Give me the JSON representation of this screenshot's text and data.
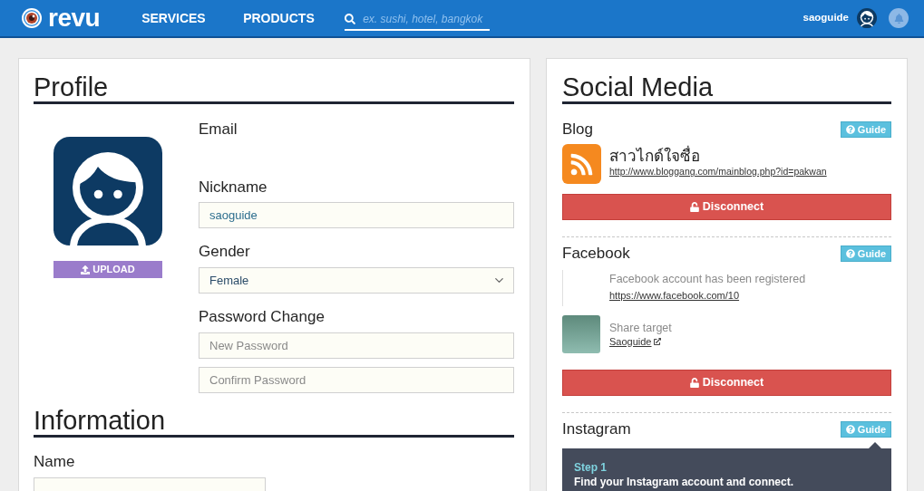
{
  "header": {
    "logo": "revu",
    "nav": [
      "SERVICES",
      "PRODUCTS"
    ],
    "search": {
      "placeholder": "ex. sushi, hotel, bangkok"
    },
    "username": "saoguide"
  },
  "profile": {
    "title": "Profile",
    "upload_button": "UPLOAD",
    "fields": [
      {
        "kind": "static",
        "label": "Email"
      },
      {
        "kind": "text",
        "label": "Nickname",
        "value": "saoguide"
      },
      {
        "kind": "select",
        "label": "Gender",
        "value": "Female"
      },
      {
        "kind": "passwords",
        "label": "Password Change",
        "inputs": [
          {
            "placeholder": "New Password"
          },
          {
            "placeholder": "Confirm Password"
          }
        ]
      }
    ]
  },
  "information": {
    "title": "Information",
    "fields": [
      {
        "label": "Name"
      }
    ]
  },
  "social_media": {
    "title": "Social Media",
    "sections": [
      {
        "kind": "blog",
        "name": "Blog",
        "guide": "Guide",
        "blog_title": "สาวไกด์ใจซื่อ",
        "url": "http://www.bloggang.com/mainblog.php?id=pakwan",
        "disconnect": "Disconnect"
      },
      {
        "kind": "facebook",
        "name": "Facebook",
        "guide": "Guide",
        "status": "Facebook account has been registered",
        "url": "https://www.facebook.com/10",
        "share_label": "Share target",
        "share_link": "Saoguide",
        "disconnect": "Disconnect"
      },
      {
        "kind": "instagram",
        "name": "Instagram",
        "guide": "Guide",
        "guide_popover": {
          "step": "Step 1",
          "text": "Find your Instagram account and connect."
        }
      }
    ]
  }
}
